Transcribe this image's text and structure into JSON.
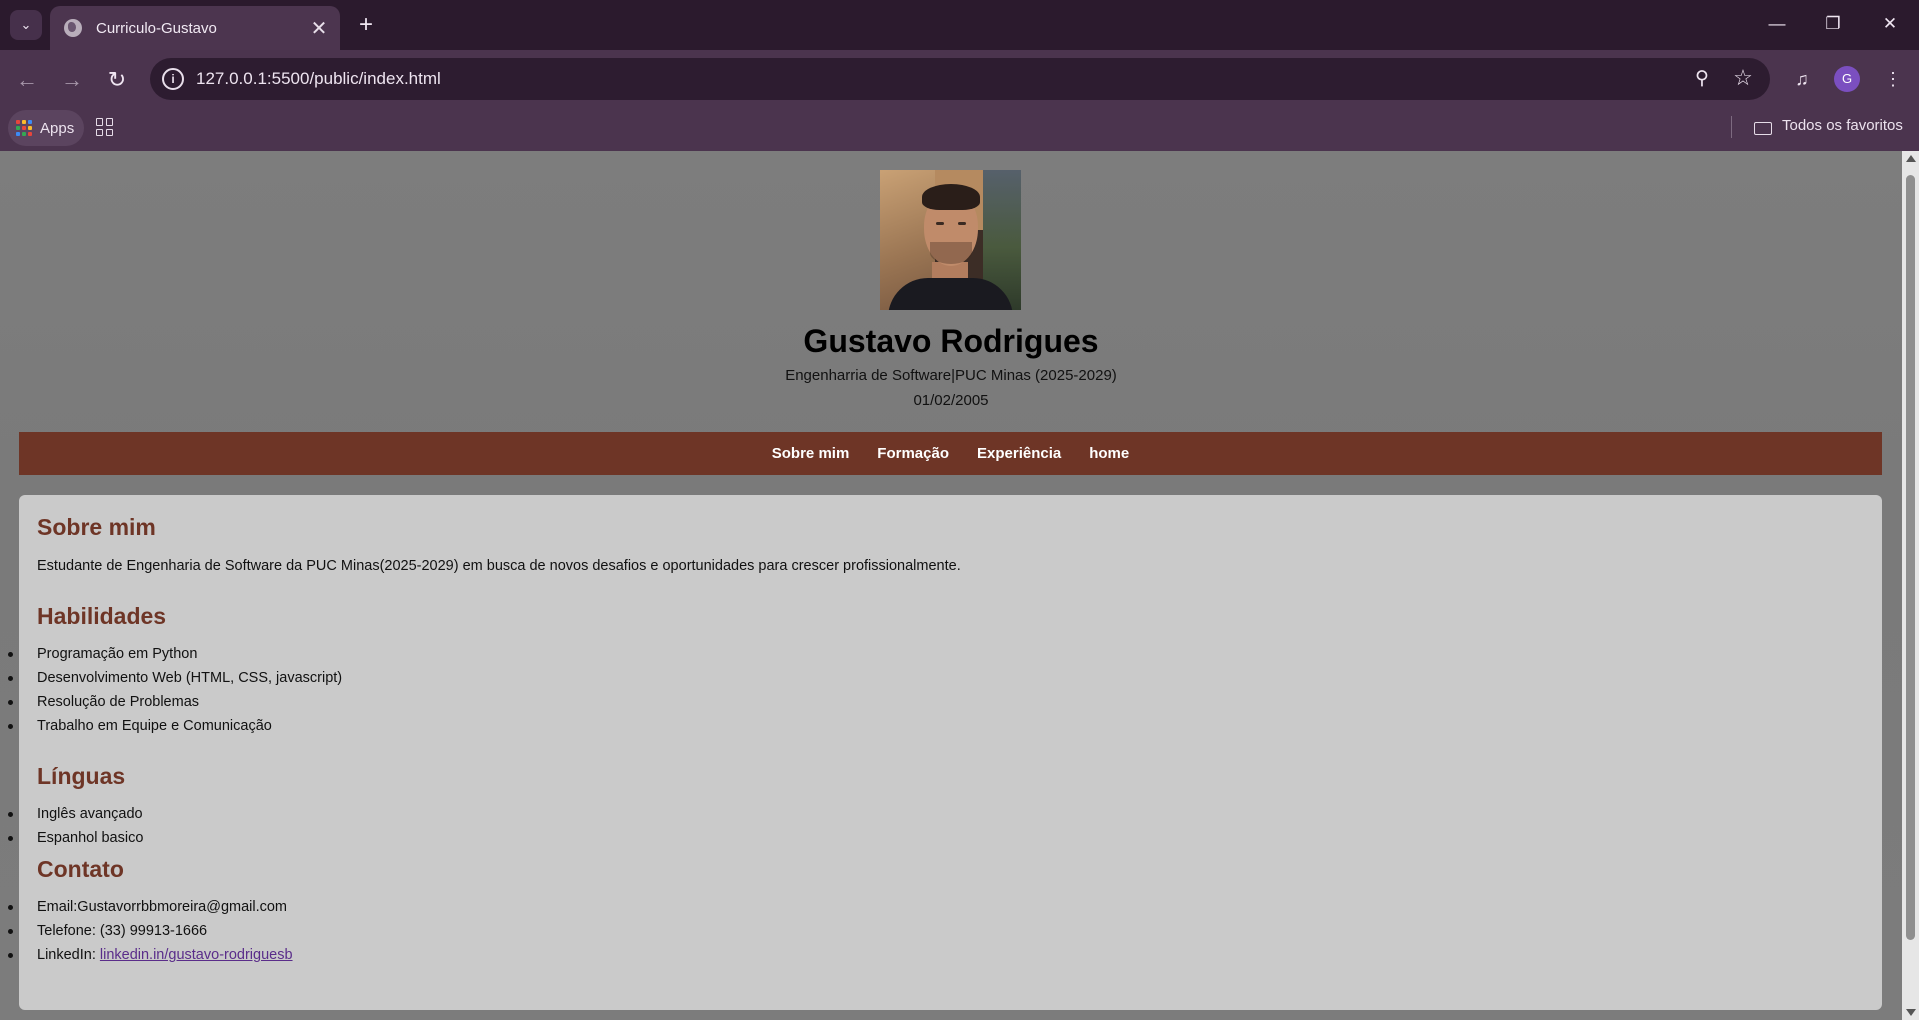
{
  "browser": {
    "tab_title": "Curriculo-Gustavo",
    "url": "127.0.0.1:5500/public/index.html",
    "profile_initial": "G",
    "bookmarks": {
      "apps_label": "Apps",
      "all_bookmarks_label": "Todos os favoritos"
    }
  },
  "header": {
    "name": "Gustavo Rodrigues",
    "subtitle": "Engenharria de Software|PUC Minas (2025-2029)",
    "birthdate": "01/02/2005"
  },
  "nav": {
    "items": [
      {
        "label": "Sobre mim"
      },
      {
        "label": "Formação"
      },
      {
        "label": "Experiência"
      },
      {
        "label": "home"
      }
    ]
  },
  "about": {
    "heading": "Sobre mim",
    "text": "Estudante de Engenharia de Software da PUC Minas(2025-2029) em busca de novos desafios e oportunidades para crescer profissionalmente."
  },
  "skills": {
    "heading": "Habilidades",
    "items": [
      "Programação em Python",
      "Desenvolvimento Web (HTML, CSS, javascript)",
      "Resolução de Problemas",
      "Trabalho em Equipe e Comunicação"
    ]
  },
  "languages": {
    "heading": "Línguas",
    "items": [
      "Inglês avançado",
      "Espanhol basico"
    ]
  },
  "contact": {
    "heading": "Contato",
    "email": "Email:Gustavorrbbmoreira@gmail.com",
    "phone": "Telefone: (33) 99913-1666",
    "linkedin_label": "LinkedIn: ",
    "linkedin_link": "linkedin.in/gustavo-rodriguesb"
  },
  "colors": {
    "accent": "#6e3526",
    "card_bg": "#cacaca",
    "page_bg": "#7d7d7d",
    "chrome_bg": "#4b344e"
  },
  "icons": [
    "tab-list-icon",
    "globe-icon",
    "close-icon",
    "plus-icon",
    "minimize-icon",
    "restore-icon",
    "back-icon",
    "forward-icon",
    "reload-icon",
    "info-icon",
    "zoom-icon",
    "star-icon",
    "media-icon",
    "menu-icon",
    "apps-icon",
    "tab-groups-icon",
    "folder-icon"
  ]
}
